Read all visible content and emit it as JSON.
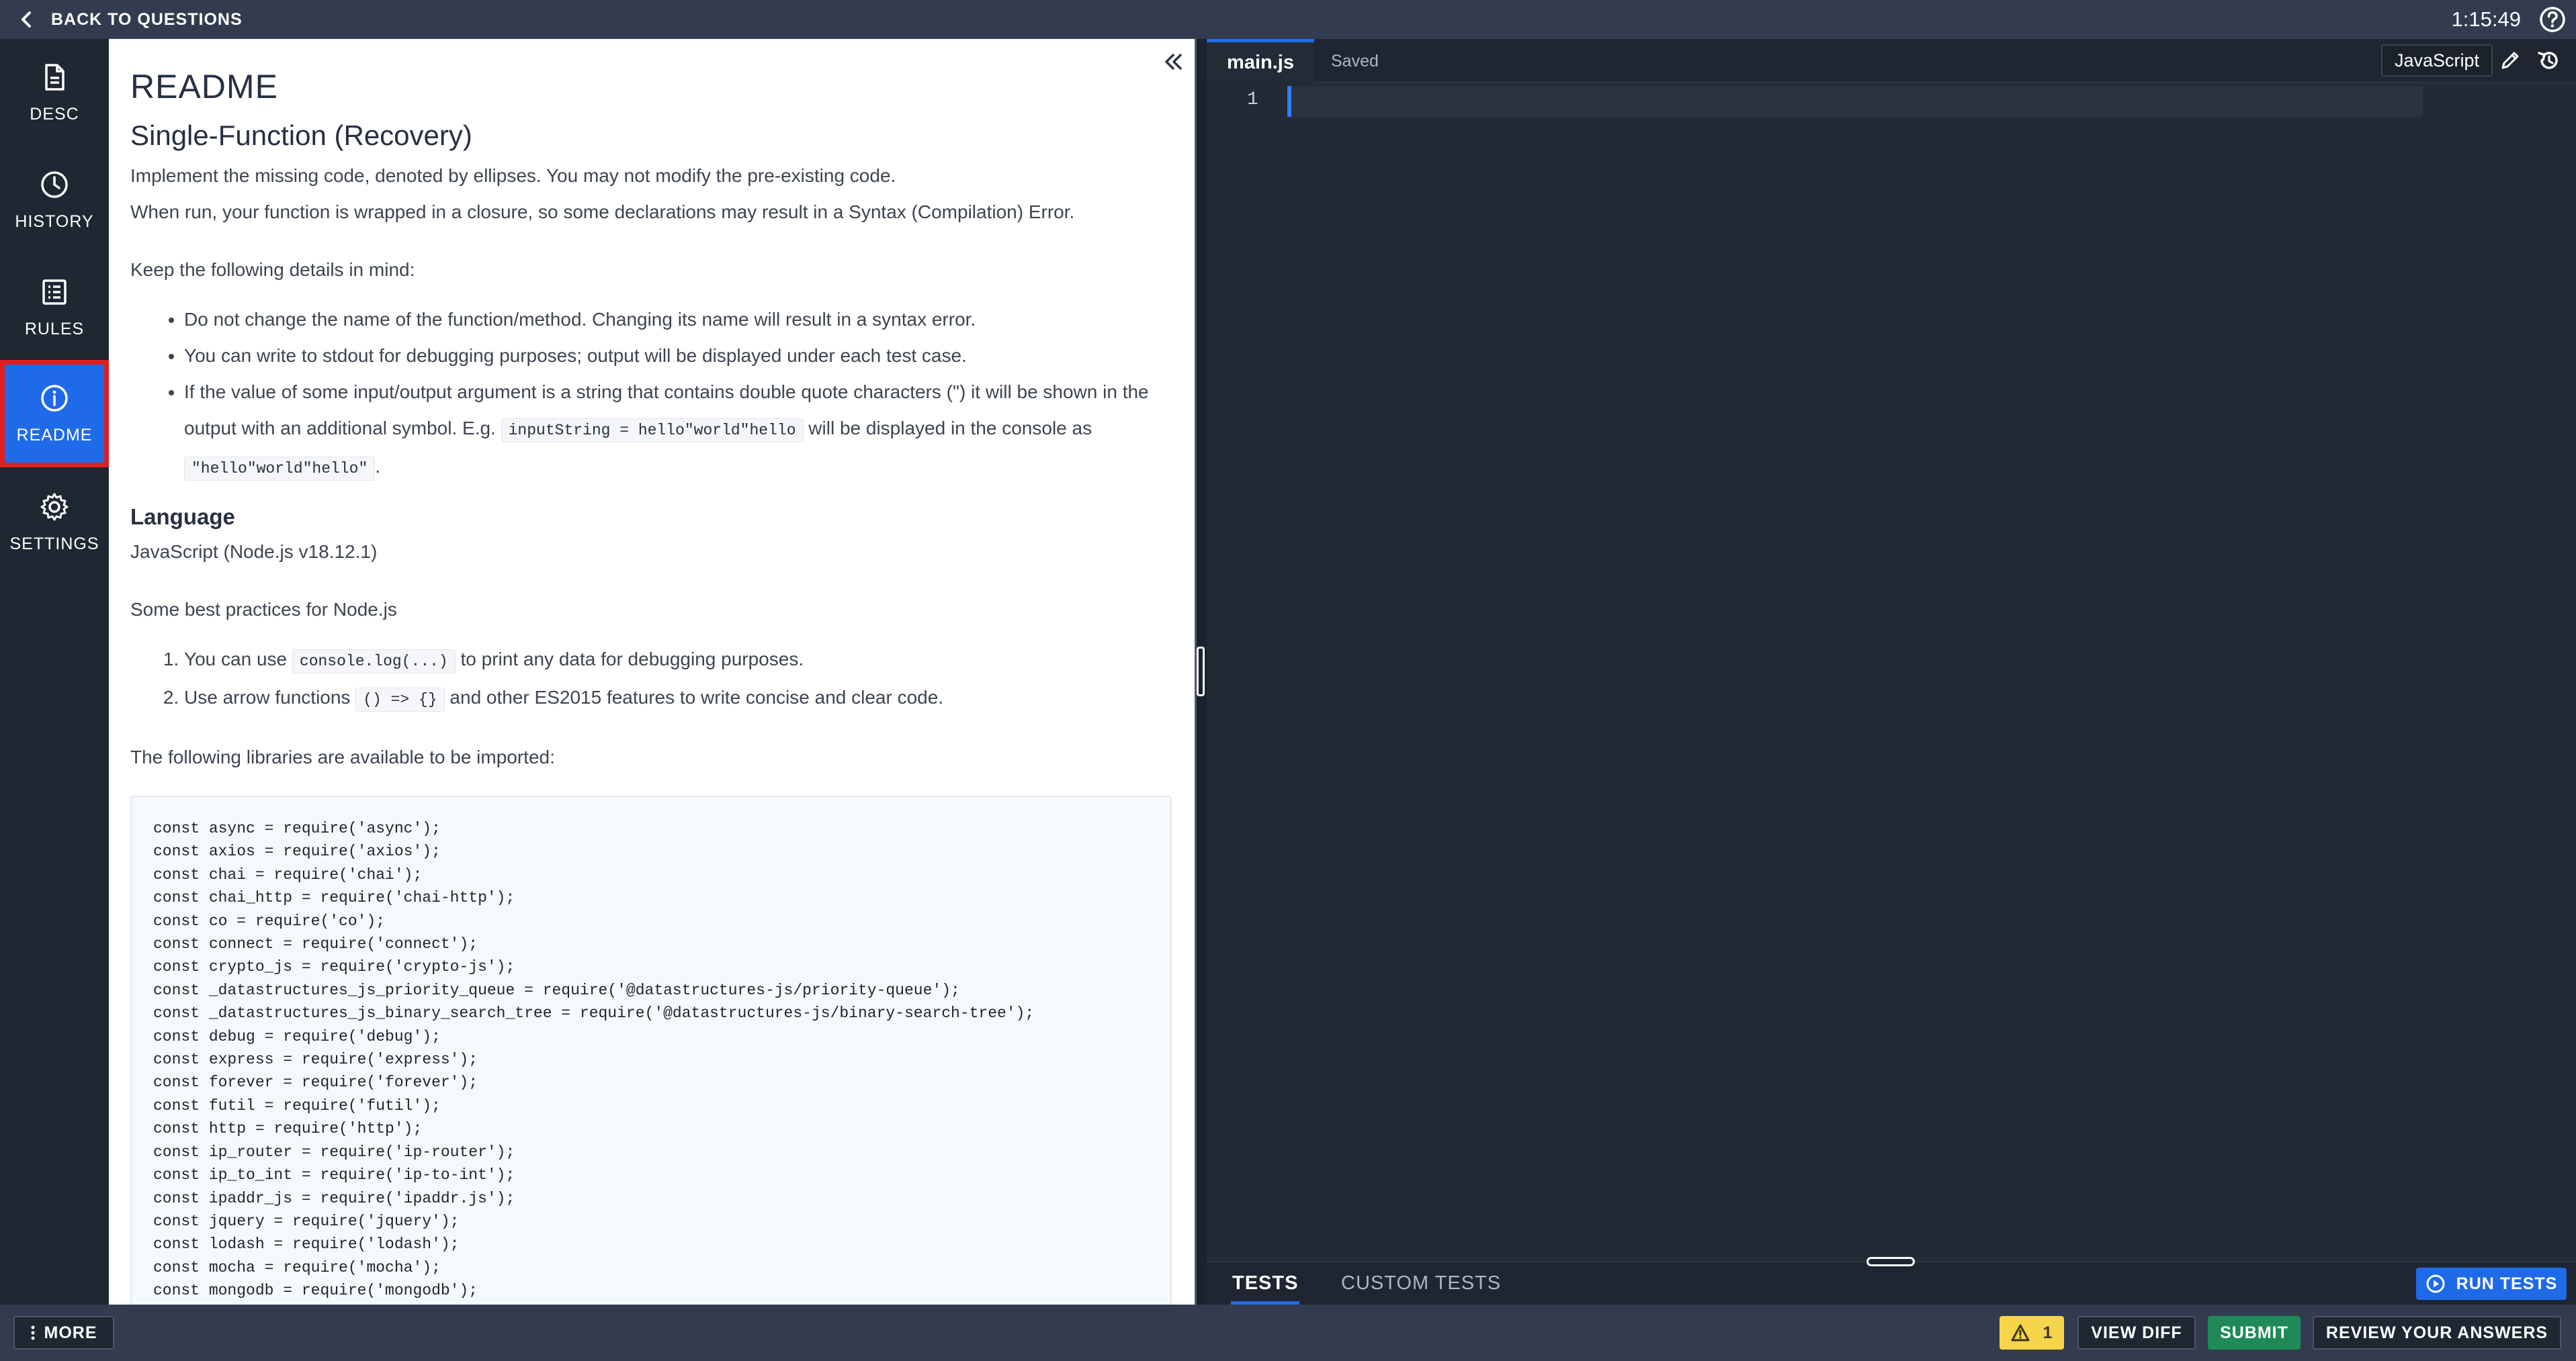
{
  "topbar": {
    "back_label": "BACK TO QUESTIONS",
    "timer": "1:15:49",
    "help_icon": "help-circle-icon"
  },
  "nav": {
    "items": [
      {
        "label": "DESC",
        "icon": "document-icon",
        "active": false
      },
      {
        "label": "HISTORY",
        "icon": "clock-icon",
        "active": false
      },
      {
        "label": "RULES",
        "icon": "list-icon",
        "active": false
      },
      {
        "label": "README",
        "icon": "info-icon",
        "active": true
      },
      {
        "label": "SETTINGS",
        "icon": "gear-icon",
        "active": false
      }
    ]
  },
  "readme": {
    "title": "README",
    "subtitle": "Single-Function (Recovery)",
    "intro1": "Implement the missing code, denoted by ellipses. You may not modify the pre-existing code.",
    "intro2": "When run, your function is wrapped in a closure, so some declarations may result in a Syntax (Compilation) Error.",
    "keep": "Keep the following details in mind:",
    "bullet1": "Do not change the name of the function/method. Changing its name will result in a syntax error.",
    "bullet2": "You can write to stdout for debugging purposes; output will be displayed under each test case.",
    "bullet3_a": "If the value of some input/output argument is a string that contains double quote characters (\") it will be shown in the output with an additional symbol. E.g.",
    "bullet3_code1": "inputString = hello\"world\"hello",
    "bullet3_b": "will be displayed in the console as",
    "bullet3_code2": "\"hello\"world\"hello\"",
    "bullet3_c": ".",
    "language_heading": "Language",
    "language_value": "JavaScript (Node.js v18.12.1)",
    "practices_intro": "Some best practices for Node.js",
    "practice1_a": "You can use",
    "practice1_code": "console.log(...)",
    "practice1_b": "to print any data for debugging purposes.",
    "practice2_a": "Use arrow functions",
    "practice2_code": "() => {}",
    "practice2_b": "and other ES2015 features to write concise and clear code.",
    "libraries_intro": "The following libraries are available to be imported:",
    "code_lines": [
      "const async = require('async');",
      "const axios = require('axios');",
      "const chai = require('chai');",
      "const chai_http = require('chai-http');",
      "const co = require('co');",
      "const connect = require('connect');",
      "const crypto_js = require('crypto-js');",
      "const _datastructures_js_priority_queue = require('@datastructures-js/priority-queue');",
      "const _datastructures_js_binary_search_tree = require('@datastructures-js/binary-search-tree');",
      "const debug = require('debug');",
      "const express = require('express');",
      "const forever = require('forever');",
      "const futil = require('futil');",
      "const http = require('http');",
      "const ip_router = require('ip-router');",
      "const ip_to_int = require('ip-to-int');",
      "const ipaddr_js = require('ipaddr.js');",
      "const jquery = require('jquery');",
      "const lodash = require('lodash');",
      "const mocha = require('mocha');",
      "const mongodb = require('mongodb');"
    ]
  },
  "editor": {
    "tab_name": "main.js",
    "saved_status": "Saved",
    "language": "JavaScript",
    "line_number": "1"
  },
  "tests": {
    "tab_tests": "TESTS",
    "tab_custom": "CUSTOM TESTS",
    "run_label": "RUN TESTS"
  },
  "bottom": {
    "more_label": "MORE",
    "warning_count": "1",
    "view_diff": "VIEW DIFF",
    "submit": "SUBMIT",
    "review": "REVIEW YOUR ANSWERS"
  },
  "colors": {
    "accent": "#1f6ae8",
    "submit": "#1f8a57",
    "warning": "#f7d54a",
    "highlight_border": "#e01e1e"
  }
}
